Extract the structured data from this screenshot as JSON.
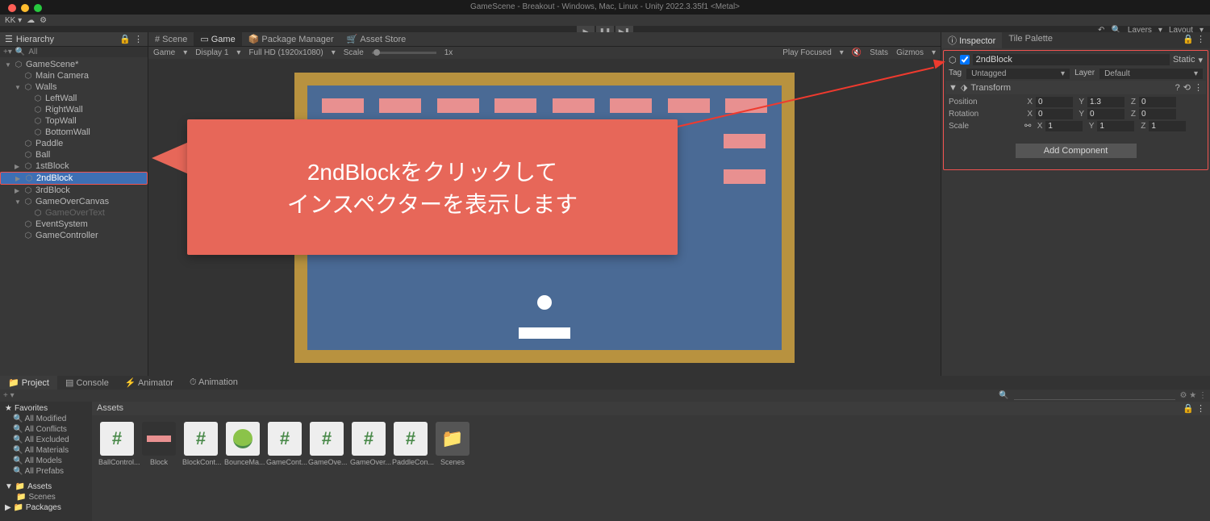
{
  "titlebar": "GameScene - Breakout - Windows, Mac, Linux - Unity 2022.3.35f1 <Metal>",
  "topbar_left": "KK ▾",
  "topbar_right": {
    "layers": "Layers",
    "layout": "Layout"
  },
  "hierarchy": {
    "title": "Hierarchy",
    "search": "All",
    "items": [
      {
        "label": "GameScene*",
        "indent": 0,
        "arrow": "▼"
      },
      {
        "label": "Main Camera",
        "indent": 1
      },
      {
        "label": "Walls",
        "indent": 1,
        "arrow": "▼"
      },
      {
        "label": "LeftWall",
        "indent": 2
      },
      {
        "label": "RightWall",
        "indent": 2
      },
      {
        "label": "TopWall",
        "indent": 2
      },
      {
        "label": "BottomWall",
        "indent": 2
      },
      {
        "label": "Paddle",
        "indent": 1
      },
      {
        "label": "Ball",
        "indent": 1
      },
      {
        "label": "1stBlock",
        "indent": 1,
        "arrow": "▶"
      },
      {
        "label": "2ndBlock",
        "indent": 1,
        "arrow": "▶",
        "selected": true
      },
      {
        "label": "3rdBlock",
        "indent": 1,
        "arrow": "▶"
      },
      {
        "label": "GameOverCanvas",
        "indent": 1,
        "arrow": "▼"
      },
      {
        "label": "GameOverText",
        "indent": 2,
        "dim": true
      },
      {
        "label": "EventSystem",
        "indent": 1
      },
      {
        "label": "GameController",
        "indent": 1
      }
    ]
  },
  "scene": {
    "tabs": [
      "Scene",
      "Game",
      "Package Manager",
      "Asset Store"
    ],
    "active_tab": 1,
    "toolbar": {
      "game": "Game",
      "display": "Display 1",
      "resolution": "Full HD (1920x1080)",
      "scale": "Scale",
      "scale_val": "1x",
      "play_focused": "Play Focused",
      "stats": "Stats",
      "gizmos": "Gizmos"
    }
  },
  "inspector": {
    "tabs": [
      "Inspector",
      "Tile Palette"
    ],
    "object_name": "2ndBlock",
    "static_label": "Static",
    "tag_label": "Tag",
    "tag_value": "Untagged",
    "layer_label": "Layer",
    "layer_value": "Default",
    "transform": {
      "title": "Transform",
      "position": {
        "label": "Position",
        "x": "0",
        "y": "1.3",
        "z": "0"
      },
      "rotation": {
        "label": "Rotation",
        "x": "0",
        "y": "0",
        "z": "0"
      },
      "scale": {
        "label": "Scale",
        "x": "1",
        "y": "1",
        "z": "1"
      }
    },
    "add_component": "Add Component"
  },
  "project": {
    "tabs": [
      "Project",
      "Console",
      "Animator",
      "Animation"
    ],
    "favorites": {
      "title": "Favorites",
      "items": [
        "All Modified",
        "All Conflicts",
        "All Excluded",
        "All Materials",
        "All Models",
        "All Prefabs"
      ]
    },
    "folders": {
      "assets": "Assets",
      "scenes": "Scenes",
      "packages": "Packages"
    },
    "assets_header": "Assets",
    "assets": [
      "BallControl...",
      "Block",
      "BlockCont...",
      "BounceMa...",
      "GameCont...",
      "GameOve...",
      "GameOver...",
      "PaddleCon...",
      "Scenes"
    ]
  },
  "callout": {
    "line1": "2ndBlockをクリックして",
    "line2": "インスペクターを表示します"
  }
}
